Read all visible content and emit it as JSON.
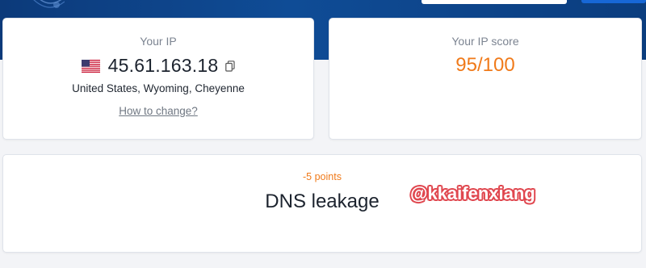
{
  "ip_card": {
    "label": "Your IP",
    "ip": "45.61.163.18",
    "location": "United States, Wyoming, Cheyenne",
    "how_to_change": "How to change?",
    "flag_icon": "us-flag-icon",
    "copy_icon": "copy-icon"
  },
  "score_card": {
    "label": "Your IP score",
    "score": "95/100"
  },
  "dns_card": {
    "points": "-5 points",
    "title": "DNS leakage"
  },
  "watermark": "@kkaifenxiang",
  "colors": {
    "header": "#0f4c96",
    "score": "#f07a1a",
    "watermark_outline": "#e0474f"
  }
}
